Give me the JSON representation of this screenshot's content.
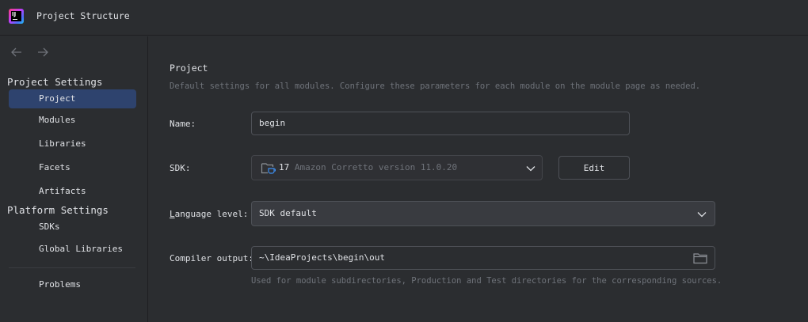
{
  "window": {
    "title": "Project Structure",
    "app_icon": "intellij-idea-icon",
    "app_icon_text": "IJ"
  },
  "sidebar": {
    "nav": {
      "back_icon": "arrow-left-icon",
      "forward_icon": "arrow-right-icon"
    },
    "sections": [
      {
        "header": "Project Settings"
      },
      {
        "header": "Platform Settings"
      }
    ],
    "items": [
      {
        "label": "Project",
        "selected": true
      },
      {
        "label": "Modules"
      },
      {
        "label": "Libraries"
      },
      {
        "label": "Facets"
      },
      {
        "label": "Artifacts"
      },
      {
        "label": "SDKs"
      },
      {
        "label": "Global Libraries"
      },
      {
        "label": "Problems"
      }
    ]
  },
  "main": {
    "heading": "Project",
    "description": "Default settings for all modules. Configure these parameters for each module on the module page as needed.",
    "name": {
      "label": "Name:",
      "value": "begin"
    },
    "sdk": {
      "label": "SDK:",
      "icon": "folder-coffee-icon",
      "version": "17",
      "name": "Amazon Corretto version 11.0.20",
      "edit_label": "Edit"
    },
    "language_level": {
      "label_mnemonic": "L",
      "label_rest": "anguage level:",
      "value": "SDK default"
    },
    "compiler_output": {
      "label": "Compiler output:",
      "value": "~\\IdeaProjects\\begin\\out",
      "browse_icon": "folder-icon",
      "hint": "Used for module subdirectories, Production and Test directories for the corresponding sources."
    }
  },
  "colors": {
    "background": "#2b2d30",
    "selection": "#2e436e",
    "border": "#4e5157",
    "muted_text": "#6f737a",
    "text": "#dfe1e5"
  }
}
